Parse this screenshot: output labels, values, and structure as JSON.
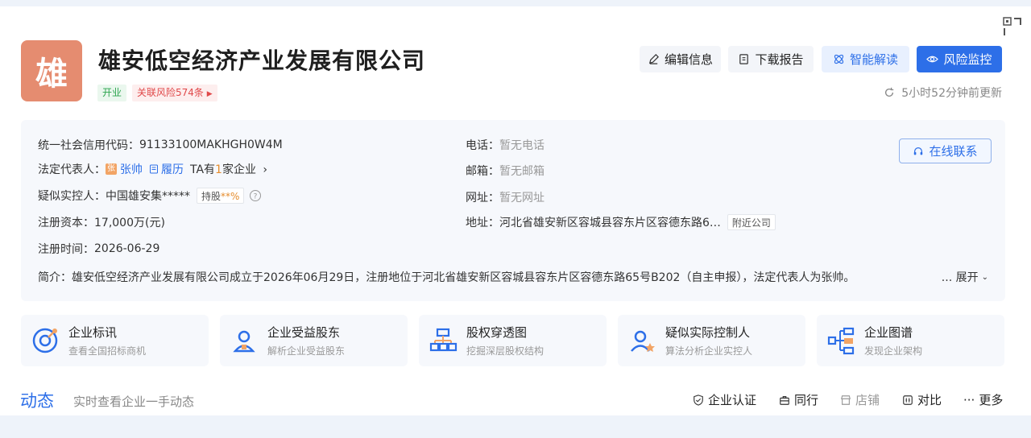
{
  "header": {
    "logo_char": "雄",
    "company_name": "雄安低空经济产业发展有限公司",
    "status_tag": "开业",
    "risk_tag": "关联风险574条",
    "buttons": {
      "edit": "编辑信息",
      "report": "下载报告",
      "ai": "智能解读",
      "monitor": "风险监控"
    },
    "update_time": "5小时52分钟前更新"
  },
  "info": {
    "credit_code_label": "统一社会信用代码：",
    "credit_code": "91133100MAKHGH0W4M",
    "legal_rep_label": "法定代表人：",
    "legal_rep_badge": "张",
    "legal_rep_name": "张帅",
    "resume_label": "履历",
    "ta_prefix": "TA有",
    "ta_count": "1",
    "ta_suffix": "家企业",
    "controller_label": "疑似实控人：",
    "controller_name": "中国雄安集*****",
    "share_prefix": "持股",
    "share_value": "**%",
    "capital_label": "注册资本：",
    "capital": "17,000万(元)",
    "reg_time_label": "注册时间：",
    "reg_time": "2026-06-29",
    "phone_label": "电话：",
    "phone": "暂无电话",
    "email_label": "邮箱：",
    "email": "暂无邮箱",
    "website_label": "网址：",
    "website": "暂无网址",
    "address_label": "地址：",
    "address": "河北省雄安新区容城县容东片区容德东路6…",
    "nearby_label": "附近公司",
    "online_contact": "在线联系",
    "intro_label": "简介：",
    "intro": "雄安低空经济产业发展有限公司成立于2026年06月29日，注册地位于河北省雄安新区容城县容东片区容德东路65号B202（自主申报），法定代表人为张帅。",
    "expand": "... 展开"
  },
  "features": [
    {
      "title": "企业标讯",
      "desc": "查看全国招标商机"
    },
    {
      "title": "企业受益股东",
      "desc": "解析企业受益股东"
    },
    {
      "title": "股权穿透图",
      "desc": "挖掘深层股权结构"
    },
    {
      "title": "疑似实际控制人",
      "desc": "算法分析企业实控人"
    },
    {
      "title": "企业图谱",
      "desc": "发现企业架构"
    }
  ],
  "dynamics": {
    "title": "动态",
    "subtitle": "实时查看企业一手动态",
    "actions": {
      "certify": "企业认证",
      "peers": "同行",
      "shop": "店铺",
      "compare": "对比",
      "more": "更多"
    }
  },
  "colors": {
    "accent": "#2d6fe8",
    "logo_bg": "#e58c70",
    "status_green": "#2ba44d",
    "risk_red": "#e0494a"
  }
}
